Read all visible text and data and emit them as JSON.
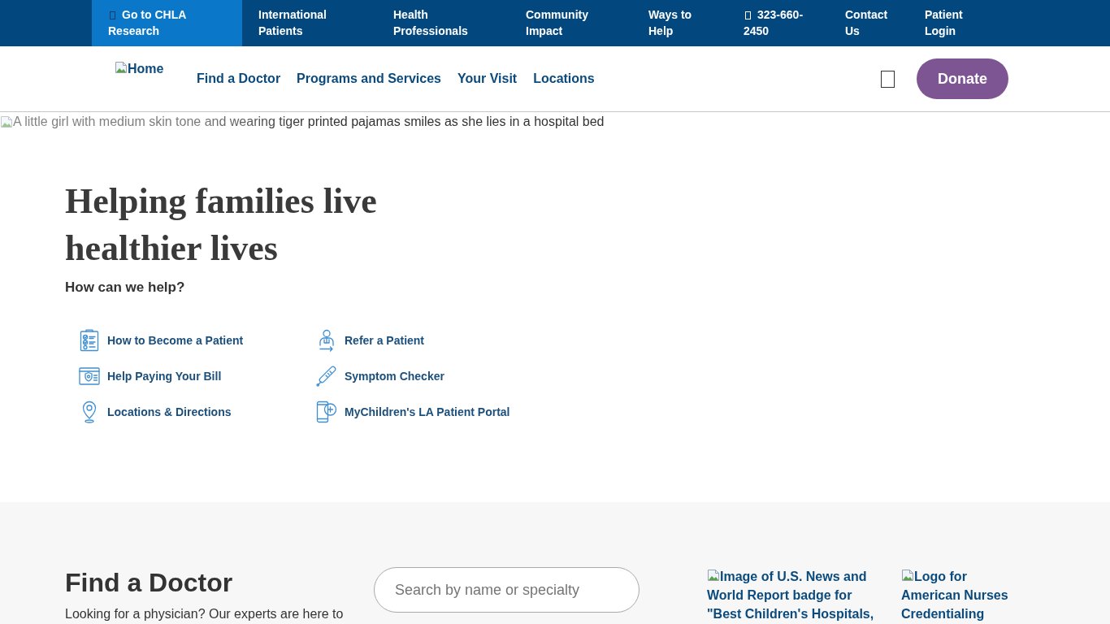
{
  "top_bar": {
    "items": [
      {
        "label": "Go to CHLA Research",
        "kind": "icon",
        "selected": true
      },
      {
        "label": "International Patients",
        "kind": "text",
        "selected": false
      },
      {
        "label": "Health Professionals",
        "kind": "text",
        "selected": false
      },
      {
        "label": "Community Impact",
        "kind": "text",
        "selected": false
      },
      {
        "label": "Ways to Help",
        "kind": "text",
        "selected": false
      },
      {
        "label": "323-660-2450",
        "kind": "icon",
        "selected": false
      },
      {
        "label": "Contact Us",
        "kind": "text",
        "selected": false
      },
      {
        "label": "Patient Login",
        "kind": "text",
        "selected": false
      }
    ]
  },
  "header": {
    "logo_alt": "Home",
    "nav": [
      "Find a Doctor",
      "Programs and Services",
      "Your Visit",
      "Locations"
    ],
    "donate_button": "Donate"
  },
  "hero": {
    "image_alt": "A little girl with medium skin tone and wearing tiger printed pajamas smiles as she lies in a hospital bed",
    "title": "Helping families live healthier lives",
    "subtitle": "How can we help?",
    "quick_links": [
      {
        "label": "How to Become a Patient",
        "kind": "clipboard"
      },
      {
        "label": "Refer a Patient",
        "kind": "person"
      },
      {
        "label": "Help Paying Your Bill",
        "kind": "card"
      },
      {
        "label": "Symptom Checker",
        "kind": "thermometer"
      },
      {
        "label": "Locations & Directions",
        "kind": "pin"
      },
      {
        "label": "MyChildren's LA Patient Portal",
        "kind": "phone"
      }
    ]
  },
  "find_doctor": {
    "title": "Find a Doctor",
    "description": "Looking for a physician? Our experts are here to",
    "search": {
      "placeholder": "Search by name or specialty"
    },
    "badges": [
      {
        "alt": "Image of U.S. News and World Report badge for \"Best Children's Hospitals,"
      },
      {
        "alt": "Logo for American Nurses Credentialing"
      }
    ]
  }
}
